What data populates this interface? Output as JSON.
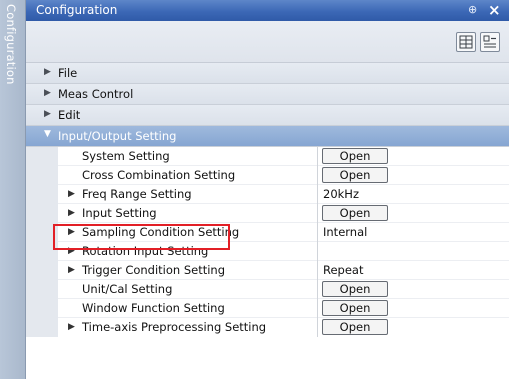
{
  "sidebar": {
    "tab_label": "Configuration"
  },
  "window": {
    "title": "Configuration",
    "pin_symbol": "⊕",
    "close_symbol": "×"
  },
  "toolbar": {
    "icons": [
      "categorized-grid-icon",
      "property-view-icon"
    ]
  },
  "categories": [
    {
      "label": "File",
      "expanded": false
    },
    {
      "label": "Meas Control",
      "expanded": false
    },
    {
      "label": "Edit",
      "expanded": false
    },
    {
      "label": "Input/Output Setting",
      "expanded": true
    }
  ],
  "rows": [
    {
      "name": "System Setting",
      "expandable": false,
      "value": "",
      "button": "Open"
    },
    {
      "name": "Cross Combination Setting",
      "expandable": false,
      "value": "",
      "button": "Open"
    },
    {
      "name": "Freq Range Setting",
      "expandable": true,
      "value": "20kHz",
      "button": ""
    },
    {
      "name": "Input Setting",
      "expandable": true,
      "value": "",
      "button": "Open"
    },
    {
      "name": "Sampling Condition Setting",
      "expandable": true,
      "value": "Internal",
      "button": ""
    },
    {
      "name": "Rotation Input Setting",
      "expandable": true,
      "value": "",
      "button": ""
    },
    {
      "name": "Trigger Condition Setting",
      "expandable": true,
      "value": "Repeat",
      "button": ""
    },
    {
      "name": "Unit/Cal Setting",
      "expandable": false,
      "value": "",
      "button": "Open"
    },
    {
      "name": "Window Function Setting",
      "expandable": false,
      "value": "",
      "button": "Open"
    },
    {
      "name": "Time-axis Preprocessing Setting",
      "expandable": true,
      "value": "",
      "button": "Open"
    }
  ],
  "accent_colors": {
    "titlebar": "#3c68b6",
    "highlight": "#e21f26",
    "expanded_category": "#86a6d2"
  }
}
